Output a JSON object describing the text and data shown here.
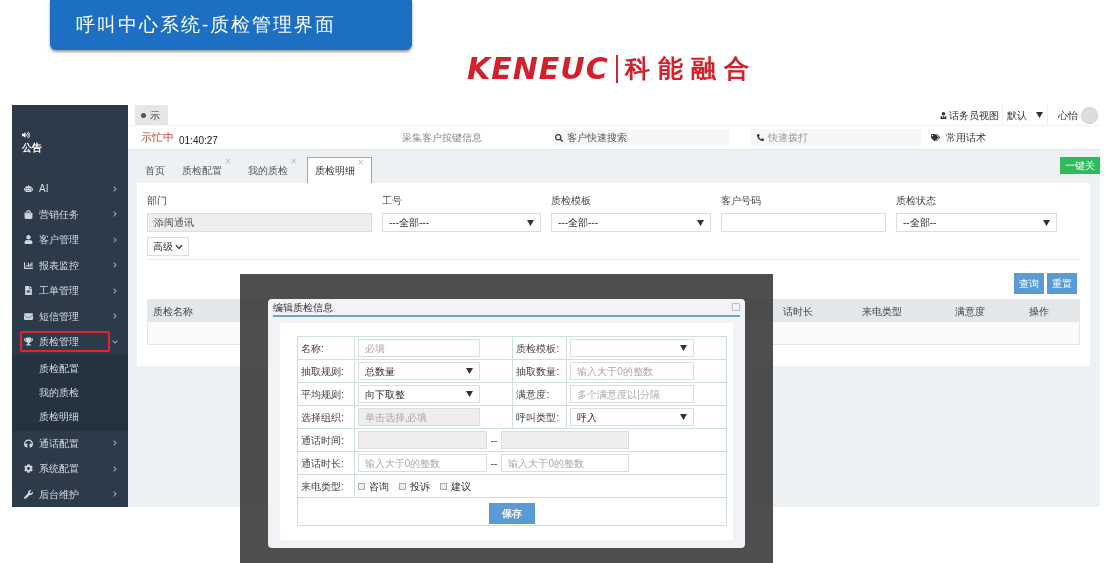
{
  "slide": {
    "title": "呼叫中心系统-质检管理界面",
    "logo": {
      "wordmark": "KENEUC",
      "name": "科能融合"
    }
  },
  "topbar": {
    "tab": "示",
    "view_link": "话务员视图",
    "mode_select": "默认",
    "user": "心怡"
  },
  "statusbar": {
    "status": "示忙中",
    "timer": "01:40:27",
    "collect_keys": "采集客户按键信息",
    "search": {
      "placeholder": "客户快速搜索"
    },
    "dial": {
      "placeholder": "快速拨打"
    },
    "scripts": "常用话术"
  },
  "sidebar": {
    "notice": "公告",
    "items": [
      {
        "label": "AI",
        "expanded": false,
        "highlighted": false
      },
      {
        "label": "营销任务",
        "expanded": false,
        "highlighted": false
      },
      {
        "label": "客户管理",
        "expanded": false,
        "highlighted": false
      },
      {
        "label": "报表监控",
        "expanded": false,
        "highlighted": false
      },
      {
        "label": "工单管理",
        "expanded": false,
        "highlighted": false
      },
      {
        "label": "短信管理",
        "expanded": false,
        "highlighted": false
      },
      {
        "label": "质检管理",
        "expanded": true,
        "highlighted": true,
        "children": [
          {
            "label": "质检配置"
          },
          {
            "label": "我的质检"
          },
          {
            "label": "质检明细"
          }
        ]
      },
      {
        "label": "通话配置",
        "expanded": false,
        "highlighted": false
      },
      {
        "label": "系统配置",
        "expanded": false,
        "highlighted": false
      },
      {
        "label": "后台维护",
        "expanded": false,
        "highlighted": false
      }
    ]
  },
  "tabs": [
    {
      "label": "首页",
      "selected": false
    },
    {
      "label": "质检配置",
      "selected": false,
      "close": "×"
    },
    {
      "label": "我的质检",
      "selected": false,
      "close": "×"
    },
    {
      "label": "质检明细",
      "selected": true,
      "close": "×"
    }
  ],
  "close_all": "一键关",
  "filters": [
    {
      "label": "部门",
      "kind": "readonly",
      "value": "添闽通讯"
    },
    {
      "label": "工号",
      "kind": "select",
      "value": "---全部---"
    },
    {
      "label": "质检模板",
      "kind": "select",
      "value": "---全部---"
    },
    {
      "label": "客户号码",
      "kind": "text"
    },
    {
      "label": "质检状态",
      "kind": "select",
      "value": "--全部--"
    }
  ],
  "advanced": "高级",
  "buttons": [
    "查询",
    "重置"
  ],
  "table": {
    "columns": [
      "质检名称",
      "话时长",
      "来电类型",
      "满意度",
      "操作"
    ]
  },
  "dialog": {
    "title": "编辑质检信息",
    "rows": [
      {
        "kind": "pair",
        "cells": [
          {
            "label": "名称:",
            "field": {
              "kind": "text",
              "placeholder": "必填"
            }
          },
          {
            "label": "质检模板:",
            "field": {
              "kind": "select"
            }
          }
        ]
      },
      {
        "kind": "pair",
        "cells": [
          {
            "label": "抽取规则:",
            "field": {
              "kind": "select",
              "value": "总数量"
            }
          },
          {
            "label": "抽取数量:",
            "field": {
              "kind": "text",
              "placeholder": "输入大于0的整数"
            }
          }
        ]
      },
      {
        "kind": "pair",
        "cells": [
          {
            "label": "平均规则:",
            "field": {
              "kind": "select",
              "value": "向下取整"
            }
          },
          {
            "label": "满意度:",
            "field": {
              "kind": "text",
              "placeholder": "多个满意度以|分隔"
            }
          }
        ]
      },
      {
        "kind": "pair",
        "cells": [
          {
            "label": "选择组织:",
            "field": {
              "kind": "disabled",
              "placeholder": "单击选择,必填"
            }
          },
          {
            "label": "呼叫类型:",
            "field": {
              "kind": "select",
              "value": "呼入"
            }
          }
        ]
      },
      {
        "kind": "range",
        "label": "通话时间:",
        "separator": "--",
        "fields": [
          {
            "kind": "disabled"
          },
          {
            "kind": "disabled"
          }
        ]
      },
      {
        "kind": "range",
        "label": "通话时长:",
        "separator": "--",
        "fields": [
          {
            "kind": "text",
            "placeholder": "输入大于0的整数"
          },
          {
            "kind": "text",
            "placeholder": "输入大于0的整数"
          }
        ]
      },
      {
        "kind": "checks",
        "label": "来电类型:",
        "options": [
          {
            "label": "咨询",
            "checked": false
          },
          {
            "label": "投诉",
            "checked": false
          },
          {
            "label": "建议",
            "checked": false
          }
        ]
      }
    ],
    "save": "保存"
  }
}
